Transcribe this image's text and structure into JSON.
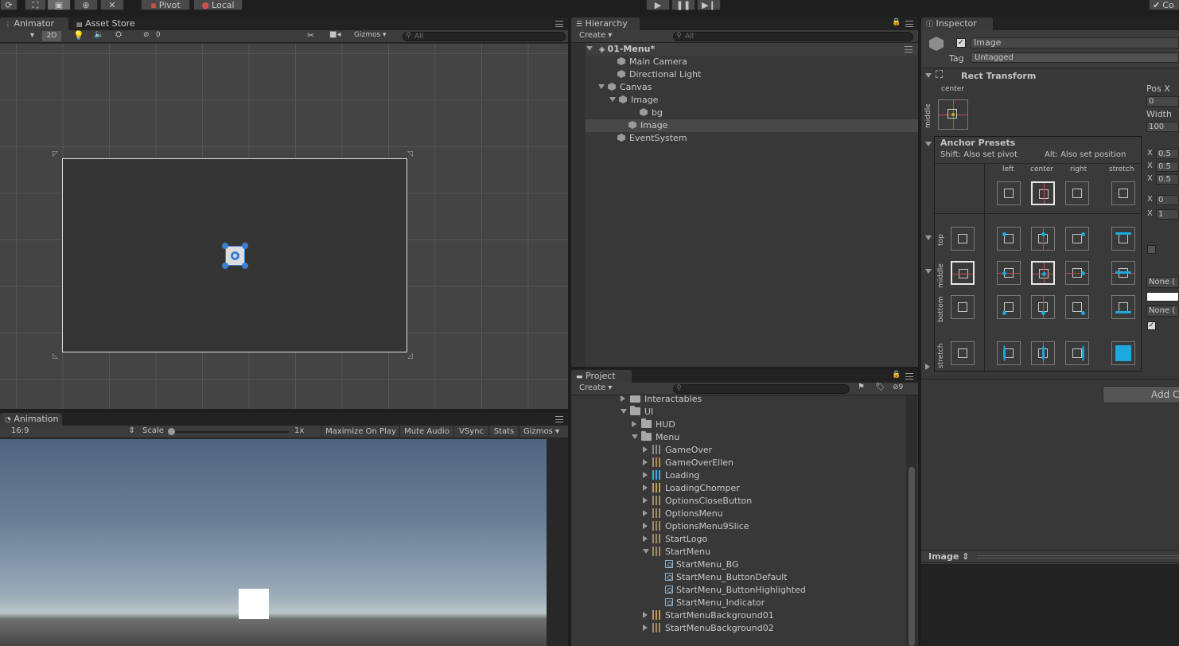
{
  "toolbar": {
    "pivot": "Pivot",
    "local": "Local",
    "collab": "Co"
  },
  "scene_panel": {
    "tabs": [
      "Animator",
      "Asset Store"
    ],
    "mode_2d": "2D",
    "hidden_count": "0",
    "gizmos": "Gizmos",
    "search_placeholder": "All"
  },
  "game_panel": {
    "tab": "Animation",
    "aspect": "16:9",
    "scale_label": "Scale",
    "scale_value": "1x",
    "buttons": [
      "Maximize On Play",
      "Mute Audio",
      "VSync",
      "Stats",
      "Gizmos"
    ]
  },
  "hierarchy": {
    "tab": "Hierarchy",
    "create": "Create",
    "search_placeholder": "All",
    "scene": "01-Menu*",
    "items": [
      {
        "label": "Main Camera",
        "depth": 1,
        "arrow": ""
      },
      {
        "label": "Directional Light",
        "depth": 1,
        "arrow": ""
      },
      {
        "label": "Canvas",
        "depth": 1,
        "arrow": "down"
      },
      {
        "label": "Image",
        "depth": 2,
        "arrow": "down"
      },
      {
        "label": "bg",
        "depth": 3,
        "arrow": ""
      },
      {
        "label": "Image",
        "depth": 2,
        "arrow": "",
        "selected": true
      },
      {
        "label": "EventSystem",
        "depth": 1,
        "arrow": ""
      }
    ]
  },
  "project": {
    "tab": "Project",
    "create": "Create",
    "hidden_count": "9",
    "items": [
      {
        "label": "Interactables",
        "depth": 0,
        "arrow": "right",
        "icon": "folder"
      },
      {
        "label": "UI",
        "depth": 0,
        "arrow": "down",
        "icon": "folder"
      },
      {
        "label": "HUD",
        "depth": 1,
        "arrow": "right",
        "icon": "folder"
      },
      {
        "label": "Menu",
        "depth": 1,
        "arrow": "down",
        "icon": "folder"
      },
      {
        "label": "GameOver",
        "depth": 2,
        "arrow": "right",
        "icon": "asset"
      },
      {
        "label": "GameOverEllen",
        "depth": 2,
        "arrow": "right",
        "icon": "asset"
      },
      {
        "label": "Loading",
        "depth": 2,
        "arrow": "right",
        "icon": "asset"
      },
      {
        "label": "LoadingChomper",
        "depth": 2,
        "arrow": "right",
        "icon": "asset"
      },
      {
        "label": "OptionsCloseButton",
        "depth": 2,
        "arrow": "right",
        "icon": "asset"
      },
      {
        "label": "OptionsMenu",
        "depth": 2,
        "arrow": "right",
        "icon": "asset"
      },
      {
        "label": "OptionsMenu9Slice",
        "depth": 2,
        "arrow": "right",
        "icon": "asset"
      },
      {
        "label": "StartLogo",
        "depth": 2,
        "arrow": "right",
        "icon": "asset"
      },
      {
        "label": "StartMenu",
        "depth": 2,
        "arrow": "down",
        "icon": "asset"
      },
      {
        "label": "StartMenu_BG",
        "depth": 3,
        "arrow": "",
        "icon": "sprite"
      },
      {
        "label": "StartMenu_ButtonDefault",
        "depth": 3,
        "arrow": "",
        "icon": "sprite"
      },
      {
        "label": "StartMenu_ButtonHighlighted",
        "depth": 3,
        "arrow": "",
        "icon": "sprite"
      },
      {
        "label": "StartMenu_Indicator",
        "depth": 3,
        "arrow": "",
        "icon": "sprite"
      },
      {
        "label": "StartMenuBackground01",
        "depth": 2,
        "arrow": "right",
        "icon": "asset"
      },
      {
        "label": "StartMenuBackground02",
        "depth": 2,
        "arrow": "right",
        "icon": "asset"
      }
    ]
  },
  "inspector": {
    "tab": "Inspector",
    "object_name": "Image",
    "tag_label": "Tag",
    "tag_value": "Untagged",
    "rect_transform": "Rect Transform",
    "anchor_h": "center",
    "anchor_v": "middle",
    "pos_x_label": "Pos X",
    "pos_x": "0",
    "width_label": "Width",
    "width": "100",
    "fields": [
      {
        "label": "X",
        "value": "0.5"
      },
      {
        "label": "X",
        "value": "0.5"
      },
      {
        "label": "X",
        "value": "0.5"
      },
      {
        "label": "X",
        "value": "0"
      },
      {
        "label": "X",
        "value": "1"
      }
    ],
    "none1": "None (",
    "none2": "None (",
    "add_component": "Add C",
    "preview_title": "Image"
  },
  "anchor_presets": {
    "title": "Anchor Presets",
    "shift_hint": "Shift: Also set pivot",
    "alt_hint": "Alt: Also set position",
    "columns": [
      "left",
      "center",
      "right",
      "stretch"
    ],
    "rows": [
      "top",
      "middle",
      "bottom",
      "stretch"
    ]
  }
}
